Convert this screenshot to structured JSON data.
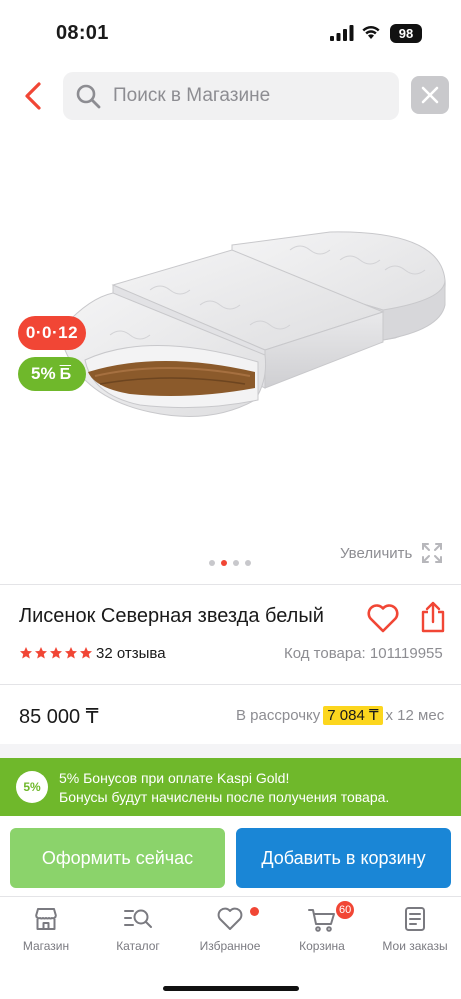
{
  "status_bar": {
    "time": "08:01",
    "battery": "98"
  },
  "search": {
    "placeholder": "Поиск в Магазине"
  },
  "product": {
    "badges": {
      "installment": "0·0·12",
      "bonus": "5%",
      "bonus_currency": "Б"
    },
    "zoom_label": "Увеличить",
    "gallery": {
      "total": 4,
      "active": 2
    },
    "title": "Лисенок Северная звезда белый",
    "rating": {
      "stars": 5,
      "max": 5
    },
    "reviews": "32 отзыва",
    "code_label": "Код товара:",
    "code": "101119955",
    "price": "85 000 ₸",
    "installment": {
      "prefix": "В рассрочку",
      "amount": "7 084 ₸",
      "suffix": "х 12 мес"
    }
  },
  "bonus_banner": {
    "percent": "5%",
    "line1": "5% Бонусов при оплате Kaspi Gold!",
    "line2": "Бонусы будут начислены после получения товара."
  },
  "actions": {
    "buy_now": "Оформить сейчас",
    "add_to_cart": "Добавить в корзину"
  },
  "colors": {
    "accent_red": "#f14635",
    "bonus_green": "#6fb82b",
    "buy_green": "#8bd36b",
    "cart_blue": "#1a86d6",
    "highlight_yellow": "#fcd61e"
  },
  "bottom_nav": {
    "items": [
      {
        "label": "Магазин",
        "icon": "store-icon"
      },
      {
        "label": "Каталог",
        "icon": "catalog-search-icon"
      },
      {
        "label": "Избранное",
        "icon": "heart-icon"
      },
      {
        "label": "Корзина",
        "icon": "cart-icon",
        "badge": "60"
      },
      {
        "label": "Мои заказы",
        "icon": "orders-icon"
      }
    ]
  }
}
